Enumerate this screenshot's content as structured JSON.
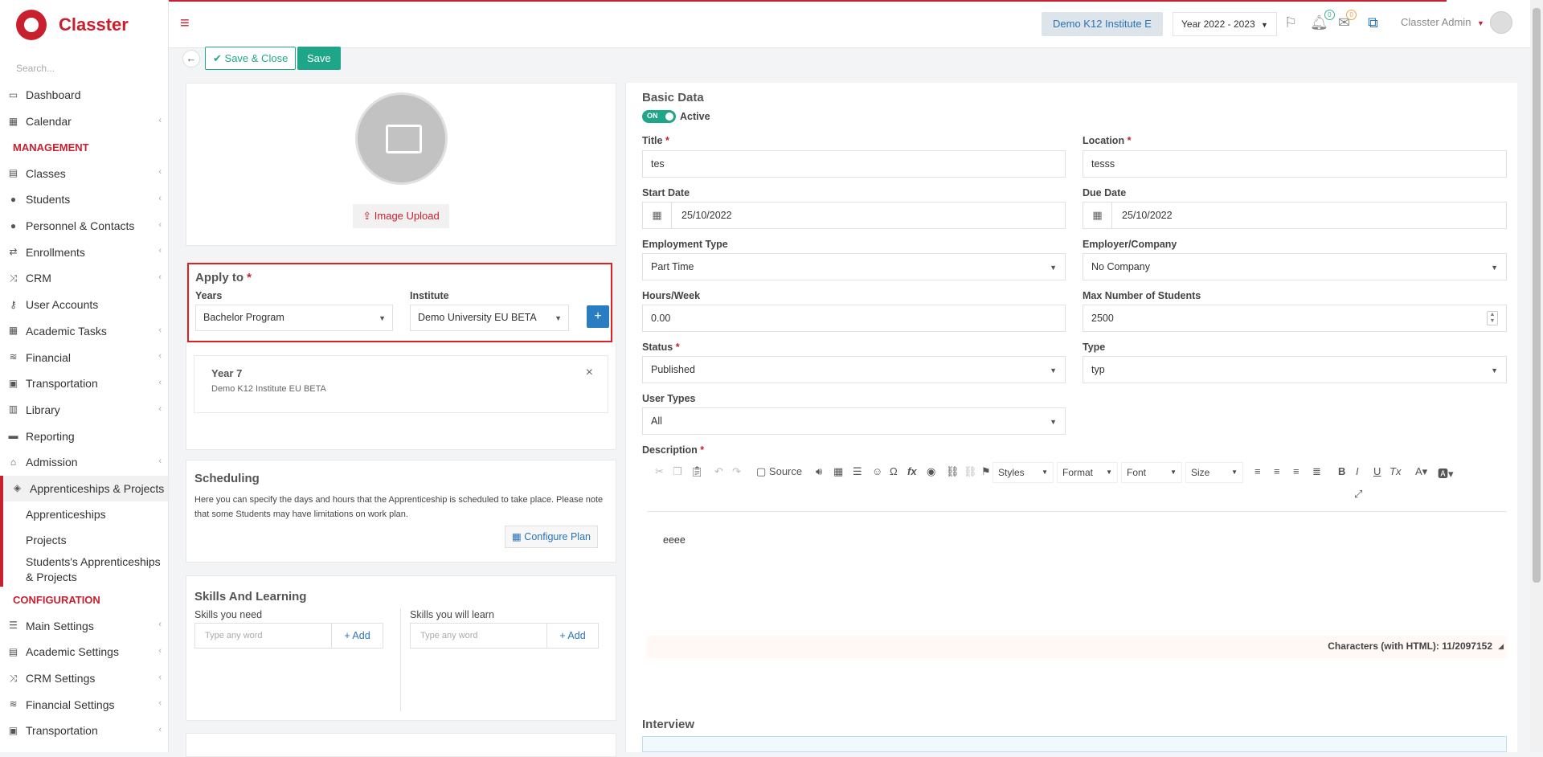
{
  "brand": {
    "name": "Classter",
    "accent": "#c8202f",
    "primary": "#1fa688",
    "link": "#2a74b8"
  },
  "sidebar": {
    "search_placeholder": "Search...",
    "top_items": [
      {
        "label": "Dashboard",
        "icon": "laptop-icon"
      },
      {
        "label": "Calendar",
        "icon": "calendar-icon"
      }
    ],
    "management_title": "MANAGEMENT",
    "management_items": [
      {
        "label": "Classes"
      },
      {
        "label": "Students"
      },
      {
        "label": "Personnel & Contacts"
      },
      {
        "label": "Enrollments"
      },
      {
        "label": "CRM"
      },
      {
        "label": "User Accounts"
      },
      {
        "label": "Academic Tasks"
      },
      {
        "label": "Financial"
      },
      {
        "label": "Transportation"
      },
      {
        "label": "Library"
      },
      {
        "label": "Reporting"
      },
      {
        "label": "Admission"
      },
      {
        "label": "Apprenticeships & Projects"
      }
    ],
    "sub_items": [
      {
        "label": "Apprenticeships"
      },
      {
        "label": "Projects"
      },
      {
        "label": "Students's Apprenticeships & Projects"
      }
    ],
    "configuration_title": "CONFIGURATION",
    "configuration_items": [
      {
        "label": "Main Settings"
      },
      {
        "label": "Academic Settings"
      },
      {
        "label": "CRM Settings"
      },
      {
        "label": "Financial Settings"
      },
      {
        "label": "Transportation"
      }
    ]
  },
  "topbar": {
    "institute": "Demo K12 Institute E",
    "year": "Year 2022 - 2023",
    "notifications_count": "0",
    "messages_count": "0",
    "user": "Classter Admin"
  },
  "actions": {
    "save_close": "Save & Close",
    "save": "Save"
  },
  "photo": {
    "upload_label": "Image Upload"
  },
  "apply_to": {
    "title": "Apply to",
    "years_label": "Years",
    "years_value": "Bachelor Program",
    "institute_label": "Institute",
    "institute_value": "Demo University EU BETA",
    "add_label": "+",
    "entry_title": "Year 7",
    "entry_subtitle": "Demo K12 Institute EU BETA"
  },
  "scheduling": {
    "title": "Scheduling",
    "text": "Here you can specify the days and hours that the Apprenticeship is scheduled to take place. Please note that some Students may have limitations on work plan.",
    "configure_label": "Configure Plan"
  },
  "skills": {
    "title": "Skills And Learning",
    "need_label": "Skills you need",
    "learn_label": "Skills you will learn",
    "placeholder": "Type any word",
    "add_label": "Add"
  },
  "basic_data": {
    "title": "Basic Data",
    "toggle_text": "ON",
    "active_label": "Active",
    "title_label": "Title",
    "title_value": "tes",
    "location_label": "Location",
    "location_value": "tesss",
    "start_date_label": "Start Date",
    "start_date_value": "25/10/2022",
    "due_date_label": "Due Date",
    "due_date_value": "25/10/2022",
    "employment_label": "Employment Type",
    "employment_value": "Part Time",
    "employer_label": "Employer/Company",
    "employer_value": "No Company",
    "hours_label": "Hours/Week",
    "hours_value": "0.00",
    "max_students_label": "Max Number of Students",
    "max_students_value": "2500",
    "status_label": "Status",
    "status_value": "Published",
    "type_label": "Type",
    "type_value": "typ",
    "user_types_label": "User Types",
    "user_types_value": "All",
    "description_label": "Description"
  },
  "editor": {
    "source_label": "Source",
    "styles_label": "Styles",
    "format_label": "Format",
    "font_label": "Font",
    "size_label": "Size",
    "content": "eeee",
    "char_count_label": "Characters (with HTML): 11/2097152"
  },
  "interview": {
    "title": "Interview"
  }
}
